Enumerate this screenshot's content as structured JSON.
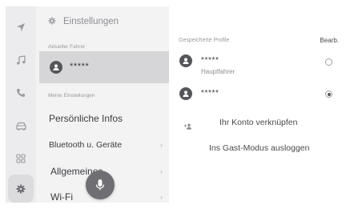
{
  "sidebar_icons": [
    "navigation-arrow-icon",
    "music-note-icon",
    "phone-icon",
    "car-icon",
    "apps-grid-icon",
    "gear-icon"
  ],
  "panel": {
    "title": "Einstellungen",
    "current_driver_label": "Aktueller Fahrer",
    "current_driver_name": "*****",
    "my_settings_label": "Meine Einstellungen",
    "menu": [
      {
        "label": "Persönliche Infos",
        "chevron": ""
      },
      {
        "label": "Bluetooth u. Geräte",
        "chevron": "›"
      },
      {
        "label": "Allgemeines",
        "chevron": "›"
      },
      {
        "label": "Wi-Fi",
        "chevron": "›"
      }
    ]
  },
  "profiles": {
    "header": "Gespeicherte Profile",
    "edit_label": "Bearb.",
    "items": [
      {
        "name": "*****",
        "role": "Hauptfahrer",
        "selected": false
      },
      {
        "name": "*****",
        "role": "",
        "selected": true
      }
    ],
    "link_account_label": "Ihr Konto verknüpfen",
    "guest_logout_label": "Ins Gast-Modus ausloggen"
  },
  "colors": {
    "rail_bg": "#ececee",
    "panel_bg": "#f3f3f4",
    "selected_row_bg": "#d6d6d8",
    "avatar": "#55565a",
    "mic_button": "#6f6f73"
  }
}
